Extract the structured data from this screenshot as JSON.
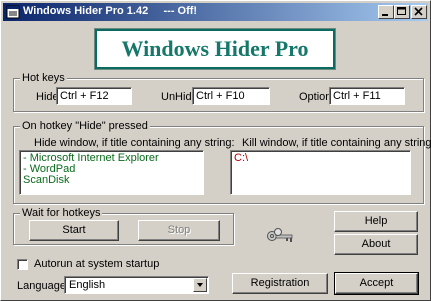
{
  "window": {
    "title": "Windows Hider Pro 1.42     --- Off!",
    "banner": "Windows Hider Pro"
  },
  "hotkeys": {
    "legend": "Hot keys",
    "hide_label": "Hide",
    "hide_value": "Ctrl + F12",
    "unhide_label": "UnHide",
    "unhide_value": "Ctrl + F10",
    "options_label": "Options",
    "options_value": "Ctrl + F11"
  },
  "on_hide": {
    "legend": "On hotkey \"Hide\" pressed",
    "hide_window_label": "Hide window, if title containing any string:",
    "hide_window_items": [
      "- Microsoft Internet Explorer",
      "- WordPad",
      "ScanDisk"
    ],
    "kill_window_label": "Kill window, if title containing any string:",
    "kill_window_items": [
      "C:\\"
    ]
  },
  "wait": {
    "legend": "Wait for hotkeys",
    "start_label": "Start",
    "stop_label": "Stop"
  },
  "buttons": {
    "help": "Help",
    "about": "About",
    "registration": "Registration",
    "accept": "Accept"
  },
  "autorun": {
    "label": "Autorun at system startup",
    "checked": false
  },
  "language": {
    "label": "Language",
    "selected": "English"
  },
  "colors": {
    "title_gradient_start": "#0a246a",
    "title_gradient_end": "#a6caf0",
    "banner_text": "#15786a",
    "hide_list_text": "#0a6b1c",
    "kill_list_text": "#b00000"
  },
  "icons": {
    "app": "app-window-icon",
    "keys": "keys-icon"
  }
}
